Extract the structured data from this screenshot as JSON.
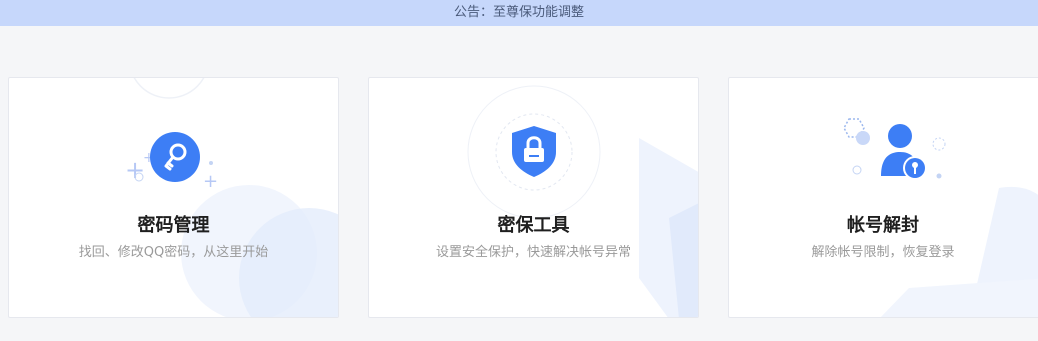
{
  "notice": {
    "text": "公告：至尊保功能调整"
  },
  "cards": [
    {
      "title": "密码管理",
      "desc": "找回、修改QQ密码，从这里开始",
      "icon": "key-icon"
    },
    {
      "title": "密保工具",
      "desc": "设置安全保护，快速解决帐号异常",
      "icon": "shield-lock-icon"
    },
    {
      "title": "帐号解封",
      "desc": "解除帐号限制，恢复登录",
      "icon": "user-lock-icon"
    }
  ],
  "colors": {
    "notice_bg": "#c6d7fb",
    "accent_blue": "#3d7ef5",
    "title": "#1f1f1f",
    "desc": "#9a9a9a"
  }
}
